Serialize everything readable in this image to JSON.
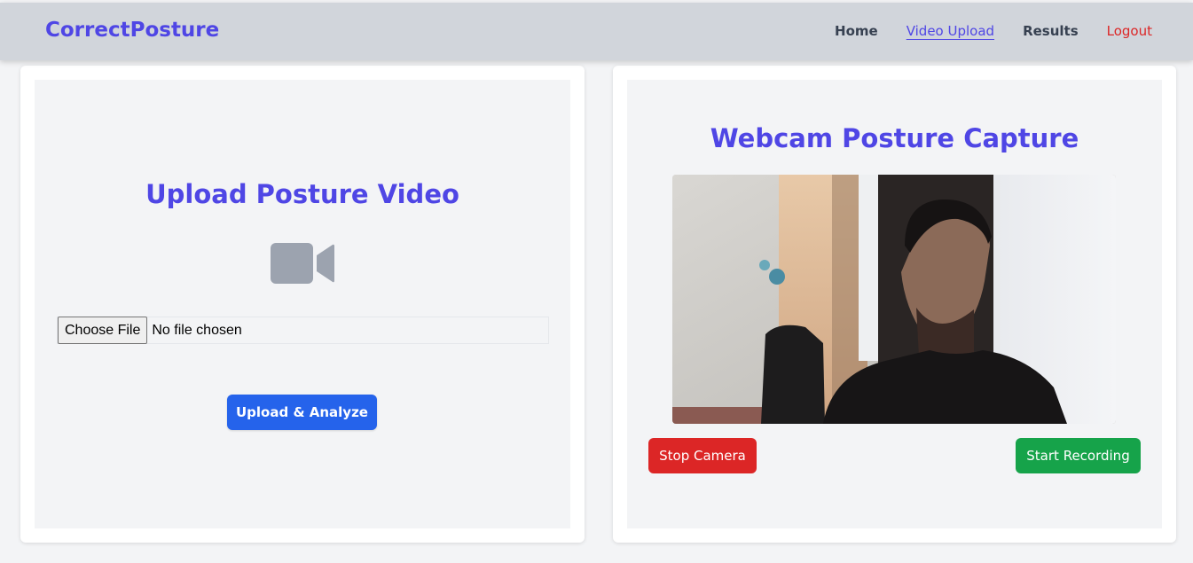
{
  "navbar": {
    "brand": "CorrectPosture",
    "links": [
      {
        "label": "Home",
        "active": false
      },
      {
        "label": "Video Upload",
        "active": true
      },
      {
        "label": "Results",
        "active": false
      },
      {
        "label": "Logout",
        "active": false
      }
    ]
  },
  "upload": {
    "title": "Upload Posture Video",
    "icon": "video-camera-icon",
    "file_button_label": "Choose File",
    "file_status": "No file chosen",
    "submit_label": "Upload & Analyze"
  },
  "webcam": {
    "title": "Webcam Posture Capture",
    "stop_label": "Stop Camera",
    "record_label": "Start Recording"
  },
  "colors": {
    "brand": "#4f46e5",
    "upload_button": "#2563eb",
    "stop_button": "#dc2626",
    "record_button": "#16a34a",
    "logout": "#dc2626",
    "icon": "#9ca3af"
  }
}
